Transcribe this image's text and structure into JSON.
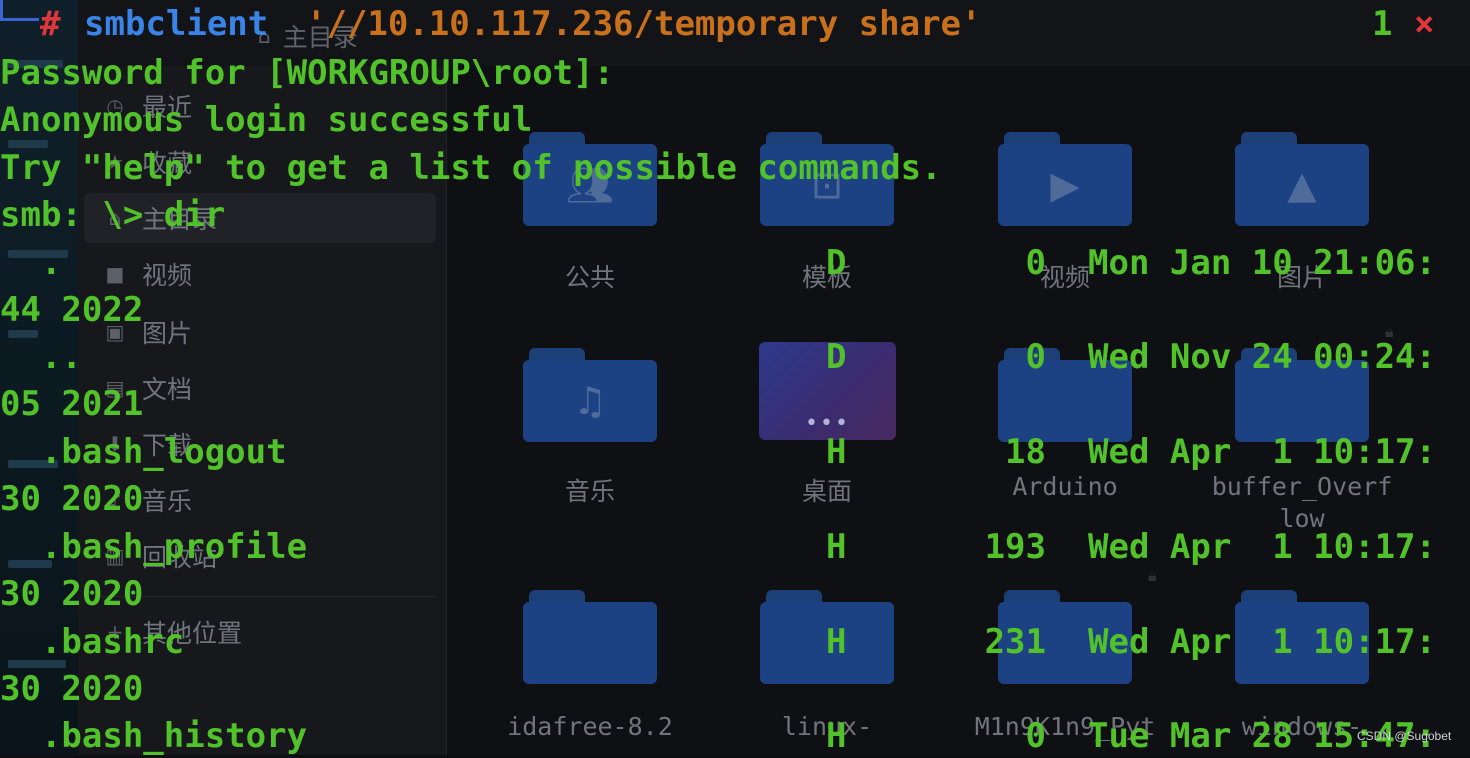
{
  "file_manager": {
    "location": "主目录",
    "sidebar": [
      {
        "label": "最近",
        "icon": "clock-icon"
      },
      {
        "label": "收藏",
        "icon": "star-icon"
      },
      {
        "label": "主目录",
        "icon": "home-icon"
      },
      {
        "label": "视频",
        "icon": "video-icon"
      },
      {
        "label": "图片",
        "icon": "image-icon"
      },
      {
        "label": "文档",
        "icon": "document-icon"
      },
      {
        "label": "下载",
        "icon": "download-icon"
      },
      {
        "label": "音乐",
        "icon": "music-icon"
      },
      {
        "label": "回收站",
        "icon": "trash-icon"
      },
      {
        "label": "其他位置",
        "icon": "plus-icon"
      }
    ],
    "folders": [
      {
        "label": "公共",
        "icon": "people-icon"
      },
      {
        "label": "模板",
        "icon": "template-icon"
      },
      {
        "label": "视频",
        "icon": "video-icon"
      },
      {
        "label": "图片",
        "icon": "image-icon"
      },
      {
        "label": "音乐",
        "icon": "music-icon"
      },
      {
        "label": "桌面",
        "icon": "desktop-icon"
      },
      {
        "label": "Arduino",
        "icon": "folder-icon"
      },
      {
        "label": "buffer_Overf",
        "label2": "low",
        "icon": "folder-icon"
      },
      {
        "label": "idafree-8.2",
        "icon": "folder-icon"
      },
      {
        "label": "linux-",
        "icon": "folder-icon"
      },
      {
        "label": "M1n9K1n9_Pyt",
        "icon": "folder-icon"
      },
      {
        "label": "windows-",
        "icon": "folder-icon"
      }
    ]
  },
  "terminal": {
    "prompt_hash": "#",
    "command": "smbclient",
    "argument": "'//10.10.117.236/temporary share'",
    "exit_status": "1",
    "exit_icon": "×",
    "lines": [
      "Password for [WORKGROUP\\root]:",
      "Anonymous login successful",
      "Try \"help\" to get a list of possible commands.",
      "smb: \\> dir"
    ],
    "entries": [
      {
        "name": "  .",
        "attr": "D",
        "size": "0",
        "date": "Mon Jan 10 21:06:",
        "wrap": "44 2022"
      },
      {
        "name": "  ..",
        "attr": "D",
        "size": "0",
        "date": "Wed Nov 24 00:24:",
        "wrap": "05 2021"
      },
      {
        "name": "  .bash_logout",
        "attr": "H",
        "size": "18",
        "date": "Wed Apr  1 10:17:",
        "wrap": "30 2020"
      },
      {
        "name": "  .bash_profile",
        "attr": "H",
        "size": "193",
        "date": "Wed Apr  1 10:17:",
        "wrap": "30 2020"
      },
      {
        "name": "  .bashrc",
        "attr": "H",
        "size": "231",
        "date": "Wed Apr  1 10:17:",
        "wrap": "30 2020"
      },
      {
        "name": "  .bash_history",
        "attr": "H",
        "size": "0",
        "date": "Tue Mar 28 15:47:",
        "wrap": ""
      }
    ]
  },
  "watermark": "CSDN @Sugobet"
}
